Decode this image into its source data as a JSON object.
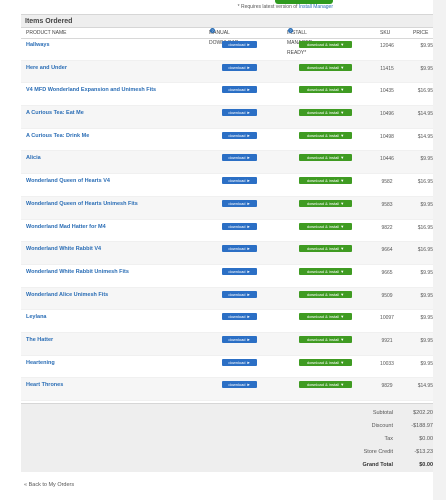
{
  "top_note": {
    "prefix": "* Requires latest version of ",
    "link": "Install Manager"
  },
  "section_title": "Items Ordered",
  "columns": {
    "name": "PRODUCT NAME",
    "manual": "MANUAL DOWNLOAD",
    "install": "INSTALL MANAGER READY*",
    "sku": "SKU",
    "price": "PRICE"
  },
  "download_label": "download ►",
  "install_label": "download & install ▼",
  "items": [
    {
      "name": "Hallways",
      "sku": "12046",
      "price": "$9.95"
    },
    {
      "name": "Here and Under",
      "sku": "11415",
      "price": "$9.95"
    },
    {
      "name": "V4 MFD Wonderland Expansion and Unimesh Fits",
      "sku": "10435",
      "price": "$16.95"
    },
    {
      "name": "A Curious Tea: Eat Me",
      "sku": "10496",
      "price": "$14.95"
    },
    {
      "name": "A Curious Tea: Drink Me",
      "sku": "10498",
      "price": "$14.95"
    },
    {
      "name": "Alicia",
      "sku": "10446",
      "price": "$9.95"
    },
    {
      "name": "Wonderland Queen of Hearts V4",
      "sku": "9582",
      "price": "$16.95"
    },
    {
      "name": "Wonderland Queen of Hearts Unimesh Fits",
      "sku": "9583",
      "price": "$9.95"
    },
    {
      "name": "Wonderland Mad Hatter for M4",
      "sku": "9822",
      "price": "$16.95"
    },
    {
      "name": "Wonderland White Rabbit V4",
      "sku": "9664",
      "price": "$16.95"
    },
    {
      "name": "Wonderland White Rabbit Unimesh Fits",
      "sku": "9665",
      "price": "$9.95"
    },
    {
      "name": "Wonderland Alice Unimesh Fits",
      "sku": "9509",
      "price": "$9.95"
    },
    {
      "name": "Leylana",
      "sku": "10097",
      "price": "$9.95"
    },
    {
      "name": "The Hatter",
      "sku": "9921",
      "price": "$9.95"
    },
    {
      "name": "Heartening",
      "sku": "10033",
      "price": "$9.95"
    },
    {
      "name": "Heart Thrones",
      "sku": "9829",
      "price": "$14.95"
    }
  ],
  "totals": [
    {
      "label": "Subtotal",
      "value": "$202.20"
    },
    {
      "label": "Discount",
      "value": "-$188.97"
    },
    {
      "label": "Tax",
      "value": "$0.00"
    },
    {
      "label": "Store Credit",
      "value": "-$13.23"
    },
    {
      "label": "Grand Total",
      "value": "$0.00"
    }
  ],
  "back_link": "« Back to My Orders",
  "colors": {
    "link": "#2a6db5",
    "download": "#2b6fc5",
    "install": "#3f9b22"
  }
}
